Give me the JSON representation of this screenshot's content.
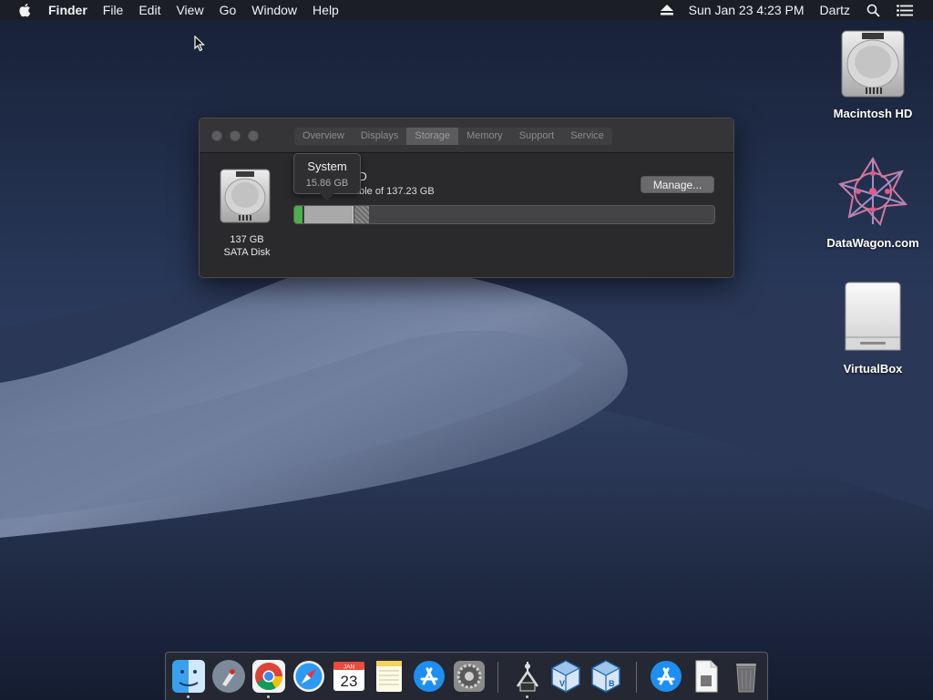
{
  "menubar": {
    "app_name": "Finder",
    "items": [
      "File",
      "Edit",
      "View",
      "Go",
      "Window",
      "Help"
    ],
    "clock": "Sun Jan 23  4:23 PM",
    "user": "Dartz"
  },
  "desktop": {
    "icons": [
      {
        "label": "Macintosh HD",
        "icon": "hard-drive-icon"
      },
      {
        "label": "DataWagon.com",
        "icon": "datawagon-logo-icon"
      },
      {
        "label": "VirtualBox",
        "icon": "external-drive-icon"
      }
    ]
  },
  "window": {
    "tabs": [
      "Overview",
      "Displays",
      "Storage",
      "Memory",
      "Support",
      "Service"
    ],
    "active_tab": "Storage",
    "disk": {
      "size": "137 GB",
      "type": "SATA Disk"
    },
    "volume_name_partial": "HD",
    "available_text_partial": "ailable of 137.23 GB",
    "manage_button": "Manage...",
    "tooltip": {
      "title": "System",
      "size": "15.86 GB"
    },
    "colors": {
      "apps": "#4cae4c",
      "system": "#a9a9a9"
    }
  },
  "dock": {
    "items": [
      {
        "name": "Finder",
        "icon": "finder-icon",
        "running": true
      },
      {
        "name": "Launchpad",
        "icon": "launchpad-icon",
        "running": false
      },
      {
        "name": "Chrome",
        "icon": "chrome-icon",
        "running": true
      },
      {
        "name": "Safari",
        "icon": "safari-icon",
        "running": false
      },
      {
        "name": "Calendar",
        "icon": "calendar-icon",
        "running": false,
        "month": "JAN",
        "day": "23"
      },
      {
        "name": "Notes",
        "icon": "notes-icon",
        "running": false
      },
      {
        "name": "App Store",
        "icon": "app-store-icon",
        "running": false
      },
      {
        "name": "System Preferences",
        "icon": "system-preferences-icon",
        "running": false
      },
      {
        "name": "Digital Color Meter",
        "icon": "color-meter-icon",
        "running": true
      },
      {
        "name": "VirtualBox",
        "icon": "virtualbox-icon",
        "running": false
      },
      {
        "name": "VirtualBox Manager",
        "icon": "virtualbox-icon",
        "running": false
      },
      {
        "name": "App Store Downloads",
        "icon": "app-store-icon",
        "running": false
      },
      {
        "name": "Documents",
        "icon": "document-icon",
        "running": false
      },
      {
        "name": "Trash",
        "icon": "trash-icon",
        "running": false
      }
    ]
  }
}
